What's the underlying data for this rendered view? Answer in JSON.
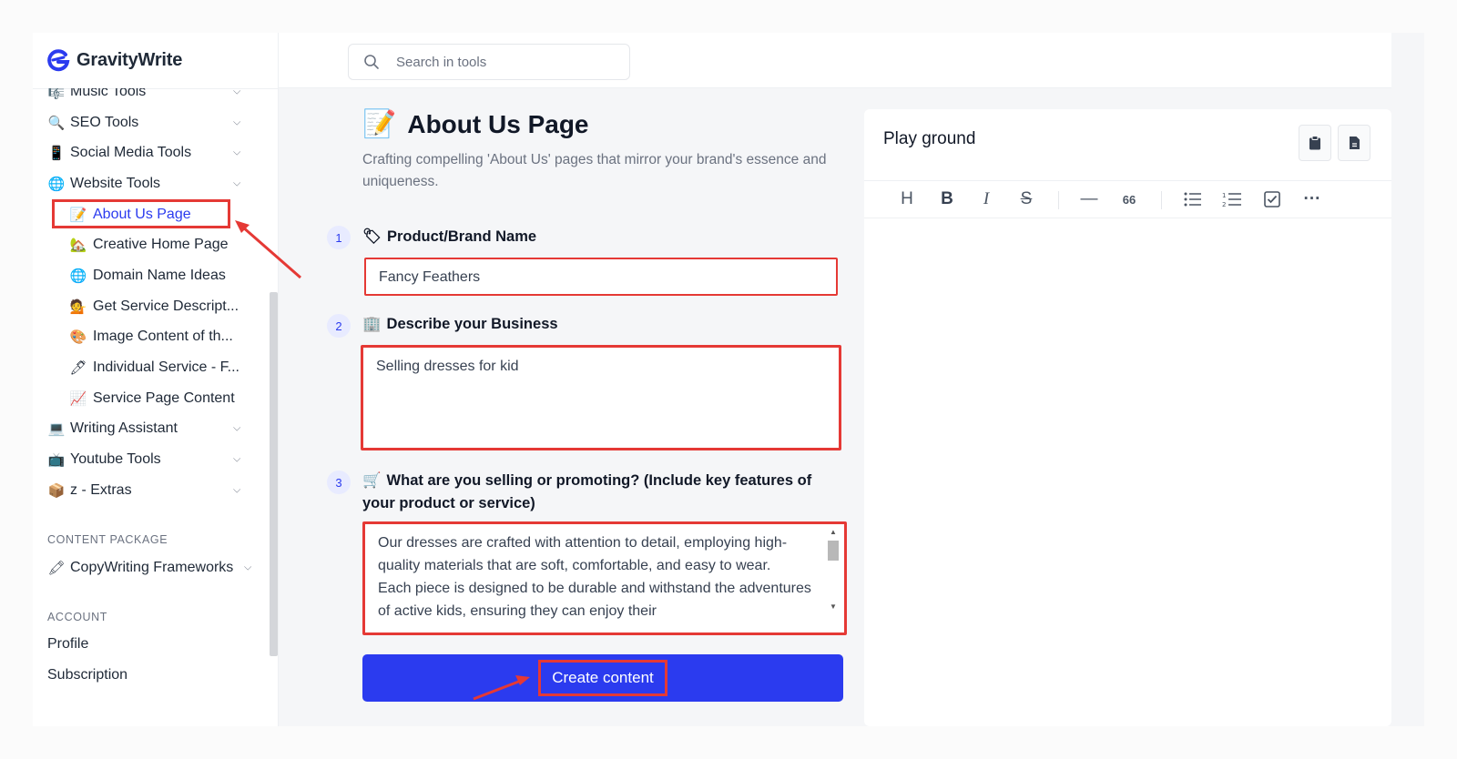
{
  "brand": {
    "name": "GravityWrite"
  },
  "search": {
    "placeholder": "Search in tools"
  },
  "sidebar": {
    "items": [
      {
        "label": "Music Tools",
        "icon": "🎼"
      },
      {
        "label": "SEO Tools",
        "icon": "🔍"
      },
      {
        "label": "Social Media Tools",
        "icon": "📱"
      },
      {
        "label": "Website Tools",
        "icon": "🌐"
      }
    ],
    "website_subitems": [
      {
        "label": "About Us Page",
        "icon": "📝"
      },
      {
        "label": "Creative Home Page",
        "icon": "🏡"
      },
      {
        "label": "Domain Name Ideas",
        "icon": "🌐"
      },
      {
        "label": "Get Service Descript...",
        "icon": "💁"
      },
      {
        "label": "Image Content of th...",
        "icon": "🎨"
      },
      {
        "label": "Individual Service - F...",
        "icon": "🖊"
      },
      {
        "label": "Service Page Content",
        "icon": "📈"
      }
    ],
    "more_items": [
      {
        "label": "Writing Assistant",
        "icon": "💻"
      },
      {
        "label": "Youtube Tools",
        "icon": "📺"
      },
      {
        "label": "z - Extras",
        "icon": "📦"
      }
    ],
    "content_package_label": "CONTENT PACKAGE",
    "copywriting": {
      "label": "CopyWriting Frameworks",
      "icon": "🖍"
    },
    "account_label": "ACCOUNT",
    "profile": "Profile",
    "subscription": "Subscription"
  },
  "main": {
    "title_icon": "📝",
    "title": "About Us Page",
    "subtitle": "Crafting compelling 'About Us' pages that mirror your brand's essence and uniqueness.",
    "fields": [
      {
        "step": "1",
        "icon": "🏷",
        "label": "Product/Brand Name",
        "value": "Fancy Feathers"
      },
      {
        "step": "2",
        "icon": "🏢",
        "label": "Describe your Business",
        "value": "Selling dresses for kid"
      },
      {
        "step": "3",
        "icon": "🛒",
        "label": "What are you selling or promoting? (Include key features of your product or service)",
        "value": "Our dresses are crafted with attention to detail, employing high-quality materials that are soft, comfortable, and easy to wear.\nEach piece is designed to be durable and withstand the adventures of active kids, ensuring they can enjoy their"
      }
    ],
    "create_label": "Create content"
  },
  "playground": {
    "title": "Play ground",
    "toolbar": [
      "H",
      "B",
      "I",
      "S",
      "—",
      "66",
      "bullet-list-icon",
      "ordered-list-icon",
      "checkbox-icon",
      "···"
    ]
  },
  "colors": {
    "accent": "#2b3bef",
    "highlight": "#e53935"
  }
}
